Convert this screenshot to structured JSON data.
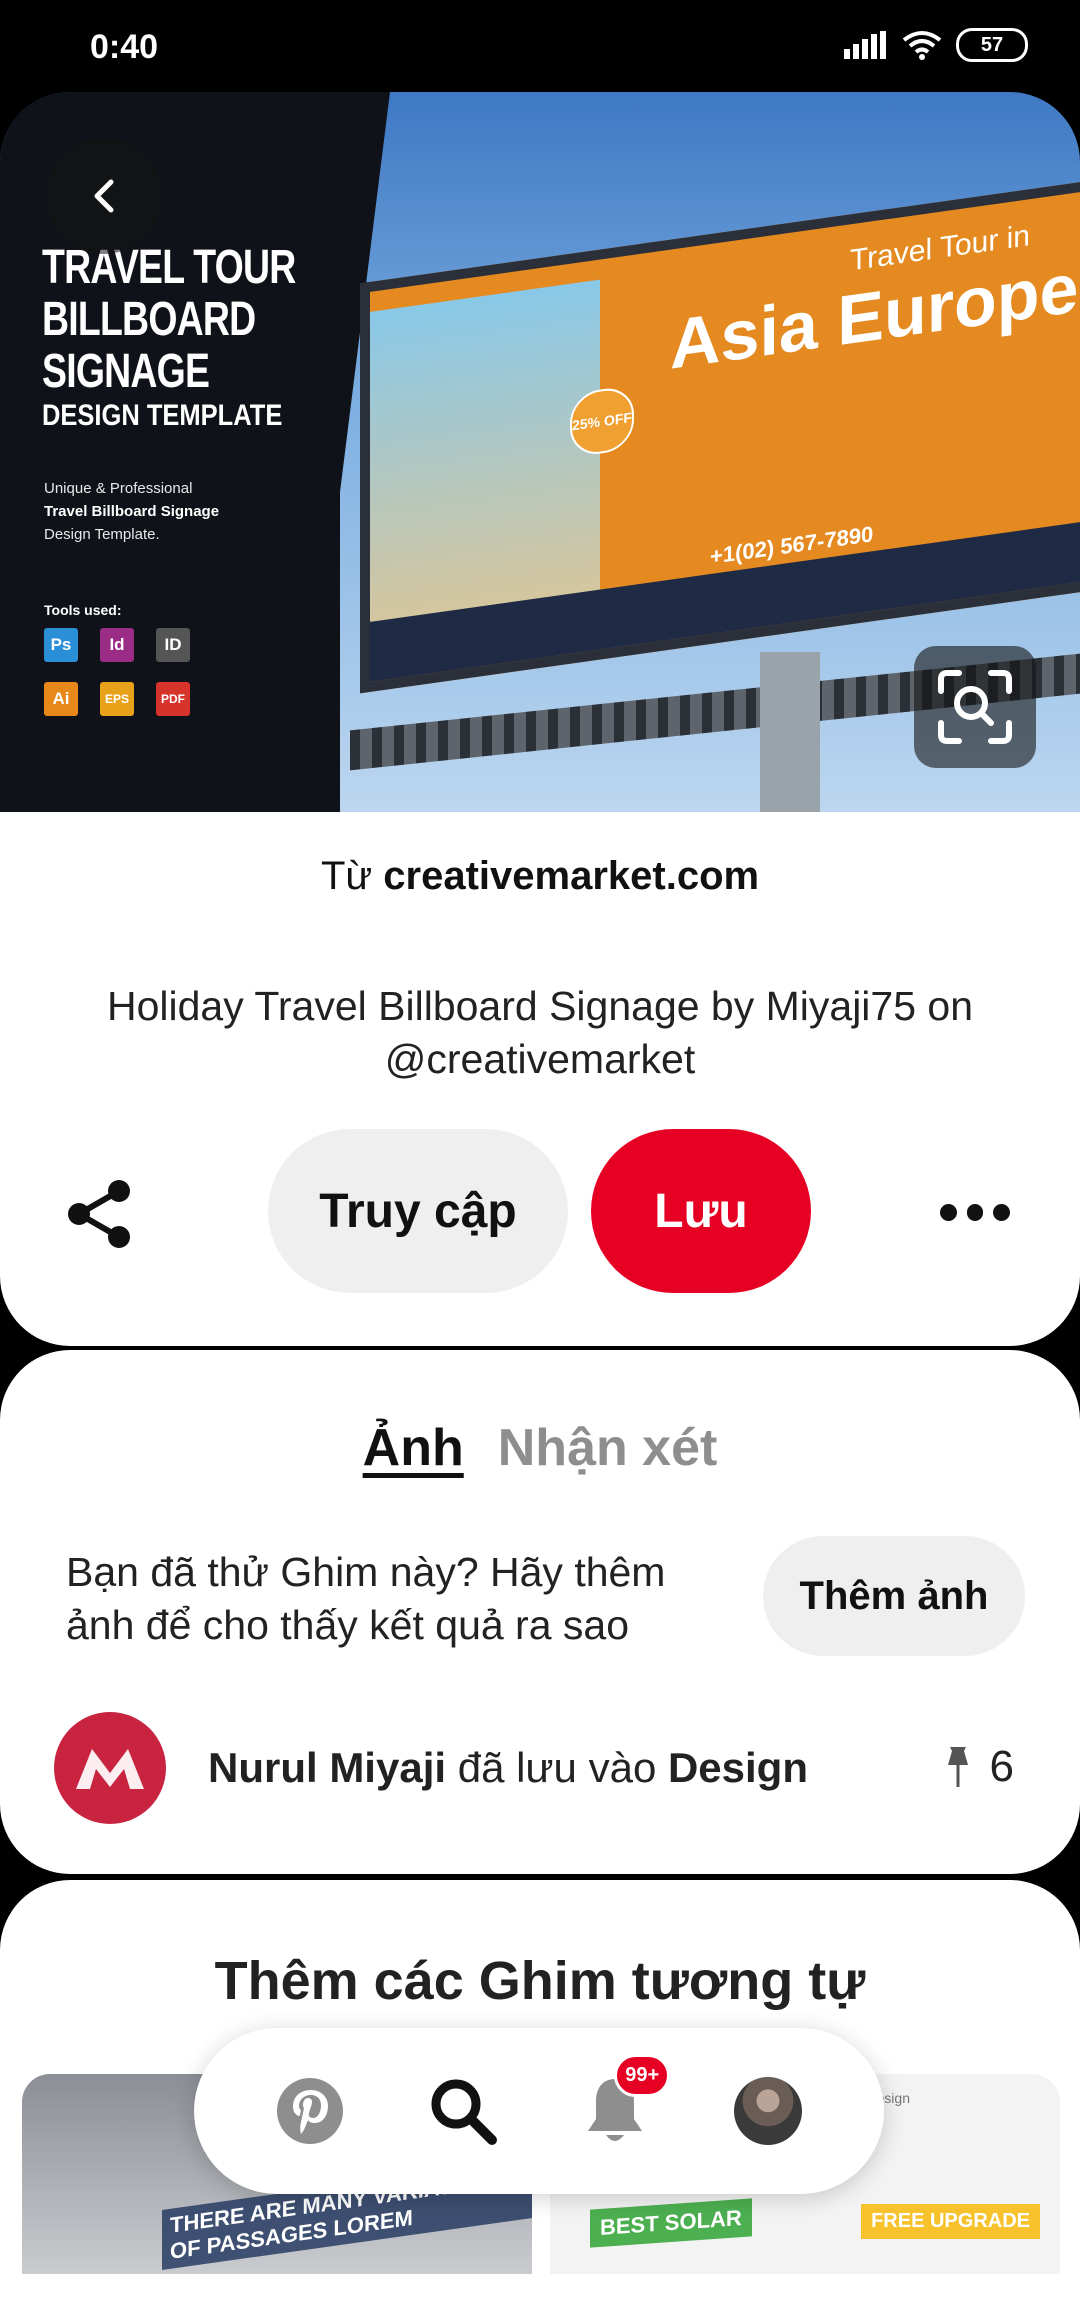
{
  "status_bar": {
    "time": "0:40",
    "battery": "57"
  },
  "hero": {
    "headline": "TRAVEL TOUR BILLBOARD SIGNAGE",
    "headline_lines": [
      "TRAVEL TOUR",
      "BILLBOARD",
      "SIGNAGE"
    ],
    "subheadline": "DESIGN TEMPLATE",
    "sub_lines": [
      "Unique & Professional",
      "Travel Billboard Signage",
      "Design Template."
    ],
    "tools_label": "Tools used:",
    "tools": [
      "Ps",
      "Id",
      "ID",
      "Ai",
      "EPS",
      "PDF"
    ],
    "billboard_top": "Travel Tour in",
    "billboard_main": "Asia Europe",
    "billboard_phone": "+1(02) 567-7890",
    "billboard_offer": "25% OFF"
  },
  "pin": {
    "source_prefix": "Từ",
    "source_domain": "creativemarket.com",
    "description": "Holiday Travel Billboard Signage by Miyaji75 on @creativemarket",
    "visit_label": "Truy cập",
    "save_label": "Lưu"
  },
  "comments": {
    "tab_photos": "Ảnh",
    "tab_comments": "Nhận xét",
    "prompt": "Bạn đã thử Ghim này? Hãy thêm ảnh để cho thấy kết quả ra sao",
    "add_photo_label": "Thêm ảnh",
    "saver_name": "Nurul Miyaji",
    "saved_text": "đã lưu vào",
    "board_name": "Design",
    "save_count": "6"
  },
  "similar": {
    "title": "Thêm các Ghim tương tự",
    "left_thumb_text": "THERE ARE MANY VARIATIONS OF PASSAGES LOREM",
    "right_thumb_a": "BEST SOLAR",
    "right_thumb_b": "FREE UPGRADE",
    "right_thumb_brand": "Indesign"
  },
  "nav": {
    "badge": "99+"
  },
  "colors": {
    "accent": "#e60023",
    "button_gray": "#efefef"
  }
}
